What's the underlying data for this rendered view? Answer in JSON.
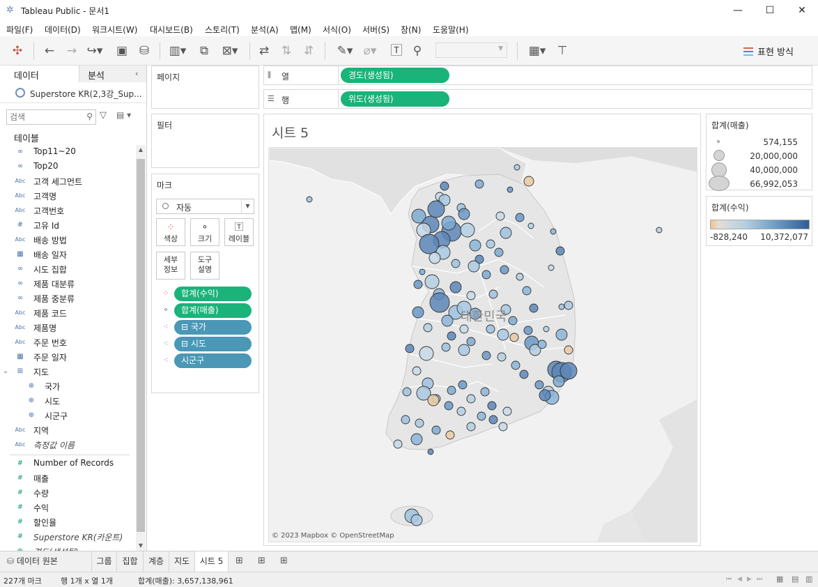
{
  "window": {
    "title": "Tableau Public - 문서1"
  },
  "menu": [
    "파일(F)",
    "데이터(D)",
    "워크시트(W)",
    "대시보드(B)",
    "스토리(T)",
    "분석(A)",
    "맵(M)",
    "서식(O)",
    "서버(S)",
    "창(N)",
    "도움말(H)"
  ],
  "toolbar": {
    "show_me": "표현 방식",
    "combo_value": ""
  },
  "left_pane": {
    "tab_data": "데이터",
    "tab_analysis": "분석",
    "datasource": "Superstore KR(2,3강_Sup...",
    "search_placeholder": "검색",
    "tables_header": "테이블",
    "fields": [
      {
        "type": "set",
        "icon": "∞",
        "name": "Top11~20"
      },
      {
        "type": "set",
        "icon": "∞",
        "name": "Top20"
      },
      {
        "type": "abc",
        "icon": "Abc",
        "name": "고객 세그먼트"
      },
      {
        "type": "abc",
        "icon": "Abc",
        "name": "고객명"
      },
      {
        "type": "abc",
        "icon": "Abc",
        "name": "고객번호"
      },
      {
        "type": "num",
        "icon": "#",
        "name": "고유 Id"
      },
      {
        "type": "abc",
        "icon": "Abc",
        "name": "배송 방법"
      },
      {
        "type": "date",
        "icon": "▦",
        "name": "배송 일자"
      },
      {
        "type": "set",
        "icon": "∞",
        "name": "시도 집합"
      },
      {
        "type": "set",
        "icon": "∞",
        "name": "제품 대분류"
      },
      {
        "type": "set",
        "icon": "∞",
        "name": "제품 중분류"
      },
      {
        "type": "abc",
        "icon": "Abc",
        "name": "제품 코드"
      },
      {
        "type": "abc",
        "icon": "Abc",
        "name": "제품명"
      },
      {
        "type": "abc",
        "icon": "Abc",
        "name": "주문 번호"
      },
      {
        "type": "date",
        "icon": "▦",
        "name": "주문 일자"
      },
      {
        "type": "hier",
        "icon": "⊞",
        "name": "지도"
      },
      {
        "type": "geo",
        "icon": "⊕",
        "name": "국가",
        "indent": true
      },
      {
        "type": "geo",
        "icon": "⊕",
        "name": "시도",
        "indent": true
      },
      {
        "type": "geo",
        "icon": "⊕",
        "name": "시군구",
        "indent": true
      },
      {
        "type": "abc",
        "icon": "Abc",
        "name": "지역"
      },
      {
        "type": "abc",
        "icon": "Abc",
        "name": "측정값 이름",
        "italic": true
      },
      {
        "type": "meas",
        "icon": "#",
        "name": "Number of Records"
      },
      {
        "type": "meas",
        "icon": "#",
        "name": "매출"
      },
      {
        "type": "meas",
        "icon": "#",
        "name": "수량"
      },
      {
        "type": "meas",
        "icon": "#",
        "name": "수익"
      },
      {
        "type": "meas",
        "icon": "#",
        "name": "할인율"
      },
      {
        "type": "meas",
        "icon": "#",
        "name": "Superstore KR(카운트)",
        "italic": true
      },
      {
        "type": "meas",
        "icon": "⊕",
        "name": "경도(생성됨)",
        "italic": true
      }
    ]
  },
  "cards": {
    "pages": "페이지",
    "filters": "필터",
    "marks": "마크",
    "mark_type": "자동",
    "btn_color": "색상",
    "btn_size": "크기",
    "btn_label": "레이블",
    "btn_detail_1": "세부",
    "btn_detail_2": "정보",
    "btn_tooltip_1": "도구",
    "btn_tooltip_2": "설명",
    "mark_pills": [
      {
        "icon": "color",
        "text": "합계(수익)",
        "style": "green"
      },
      {
        "icon": "size",
        "text": "합계(매출)",
        "style": "green"
      },
      {
        "icon": "detail",
        "text": "⊟ 국가",
        "style": "blue"
      },
      {
        "icon": "detail",
        "text": "⊟ 시도",
        "style": "blue"
      },
      {
        "icon": "detail",
        "text": "시군구",
        "style": "blue"
      }
    ]
  },
  "shelves": {
    "columns_label": "열",
    "columns_pill": "경도(생성됨)",
    "rows_label": "행",
    "rows_pill": "위도(생성됨)"
  },
  "sheet": {
    "title": "시트 5",
    "map_label": "대한민국",
    "attribution": "© 2023 Mapbox © OpenStreetMap"
  },
  "legend_size": {
    "title": "합계(매출)",
    "entries": [
      "574,155",
      "20,000,000",
      "40,000,000",
      "66,992,053"
    ]
  },
  "legend_color": {
    "title": "합계(수익)",
    "min": "-828,240",
    "max": "10,372,077"
  },
  "bottom_tabs": {
    "datasource": "데이터 원본",
    "sheets": [
      "그룹",
      "집합",
      "계층",
      "지도",
      "시트 5"
    ],
    "active": "시트 5"
  },
  "status": {
    "marks": "227개 마크",
    "rows_cols": "행 1개 x 열 1개",
    "sum": "합계(매출): 3,657,138,961"
  },
  "colors": {
    "green_pill": "#1ab37a",
    "blue_pill": "#4a97b6",
    "profit_low": "#f2c18a",
    "profit_high": "#2e5f95"
  }
}
